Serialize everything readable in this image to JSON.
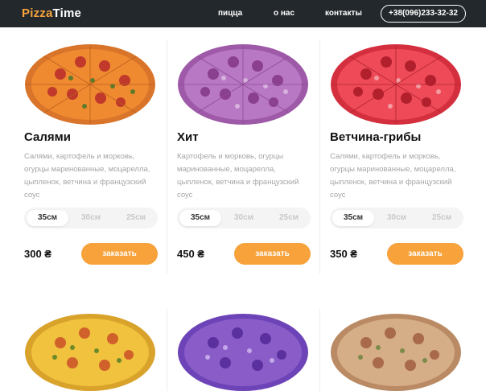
{
  "header": {
    "logo_part1": "Pizza",
    "logo_part2": "Time",
    "nav": [
      "пицца",
      "о нас",
      "контакты"
    ],
    "phone": "+38(096)233-32-32"
  },
  "products": [
    {
      "title": "Салями",
      "desc": "Салями, картофель и морковь, огурцы маринованные, моцарелла, цыпленок, ветчина и французский соус",
      "sizes": [
        "35см",
        "30см",
        "25см"
      ],
      "price": "300 ₴",
      "order_label": "заказать"
    },
    {
      "title": "Хит",
      "desc": "Картофель и морковь, огурцы маринованные, моцарелла, цыпленок, ветчина и французский соус",
      "sizes": [
        "35см",
        "30см",
        "25см"
      ],
      "price": "450 ₴",
      "order_label": "заказать"
    },
    {
      "title": "Ветчина-грибы",
      "desc": "Салями, картофель и морковь, огурцы маринованные, моцарелла, цыпленок, ветчина и французский соус",
      "sizes": [
        "35см",
        "30см",
        "25см"
      ],
      "price": "350 ₴",
      "order_label": "заказать"
    }
  ],
  "colors": {
    "header_bg": "#23282c",
    "accent": "#f7a23b",
    "pizza_tints": [
      "#e67e22",
      "#b06bc0",
      "#e53a4a",
      "#e8b83a",
      "#8a5cc8",
      "#c9a27c"
    ]
  }
}
